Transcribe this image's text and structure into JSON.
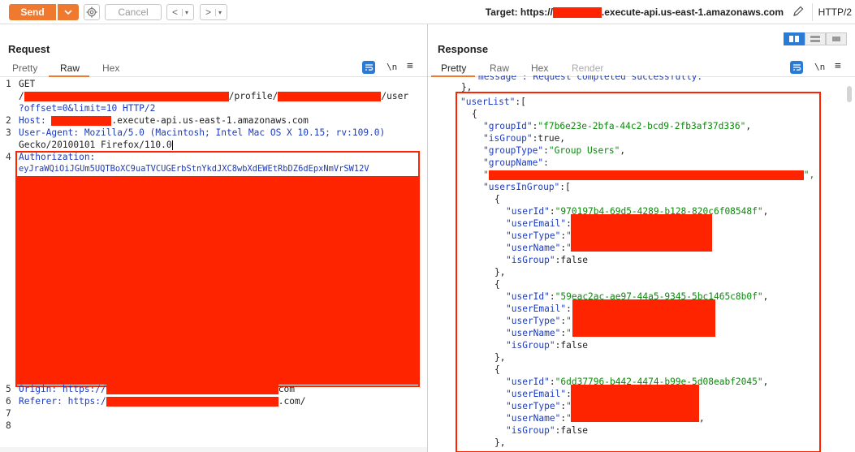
{
  "toolbar": {
    "send_label": "Send",
    "cancel_label": "Cancel",
    "back_label": "<",
    "forward_label": ">",
    "target_prefix": "Target: https://",
    "target_suffix": ".execute-api.us-east-1.amazonaws.com",
    "protocol": "HTTP/2"
  },
  "colors": {
    "accent": "#f07930",
    "redaction": "#ff2400",
    "key": "#1d3bbf",
    "string": "#0a8a0a",
    "toggle": "#2b7bd6"
  },
  "request": {
    "title": "Request",
    "tabs": [
      "Pretty",
      "Raw",
      "Hex"
    ],
    "active_tab": "Raw",
    "newline_label": "\\n",
    "line_numbers": [
      "1",
      "",
      "",
      "2",
      "3",
      "",
      "4",
      "",
      "5",
      "6",
      "7",
      "8"
    ],
    "lines": {
      "l1a": "GET",
      "l1b_start": "/",
      "l1b_mid": "/profile/",
      "l1b_end": "/user",
      "l1c": "?offset=0&limit=10 HTTP/2",
      "l2_key": "Host: ",
      "l2_val": ".execute-api.us-east-1.amazonaws.com",
      "l3": "User-Agent: Mozilla/5.0 (Macintosh; Intel Mac OS X 10.15; rv:109.0)",
      "l3b": "Gecko/20100101 Firefox/110.0",
      "l4": "Authorization:",
      "l4b": "eyJraWQiOiJGUm5UQTBoXC9uaTVCUGErbStnYkdJXC8wbXdEWEtRbDZ6dEpxNmVrSW12V",
      "l5": "Origin: https://",
      "l5_end": "com",
      "l6": "Referer: https:/",
      "l6_end": ".com/"
    }
  },
  "response": {
    "title": "Response",
    "tabs": [
      "Pretty",
      "Raw",
      "Hex",
      "Render"
    ],
    "active_tab": "Pretty",
    "newline_label": "\\n",
    "lines": {
      "top_cut": "message\":\"Request completed successfully.\"",
      "close_brace": "},",
      "userList_key": "\"userList\"",
      "userList_open": ":[",
      "obj_open": "{",
      "groupId_key": "\"groupId\"",
      "groupId_val": "\"f7b6e23e-2bfa-44c2-bcd9-2fb3af37d336\"",
      "isGroup_key": "\"isGroup\"",
      "isGroup_true": ":true,",
      "groupType_key": "\"groupType\"",
      "groupType_val": "\"Group Users\"",
      "groupName_key": "\"groupName\"",
      "usersInGroup_key": "\"usersInGroup\"",
      "users": [
        {
          "userId": "\"970197b4-69d5-4289-b128-820c6f08548f\""
        },
        {
          "userId": "\"59eac2ac-ae97-44a5-9345-5bc1465c8b0f\""
        },
        {
          "userId": "\"6dd37796-b442-4474-b99e-5d08eabf2045\""
        }
      ],
      "userId_key": "\"userId\"",
      "userEmail_key": "\"userEmail\"",
      "userType_key": "\"userType\"",
      "userName_key": "\"userName\"",
      "isGroup_false": ":false",
      "quote": "\"",
      "quote_comma": "\",",
      "comma": ",",
      "obj_close": "},",
      "obj_close_last": "},"
    }
  }
}
